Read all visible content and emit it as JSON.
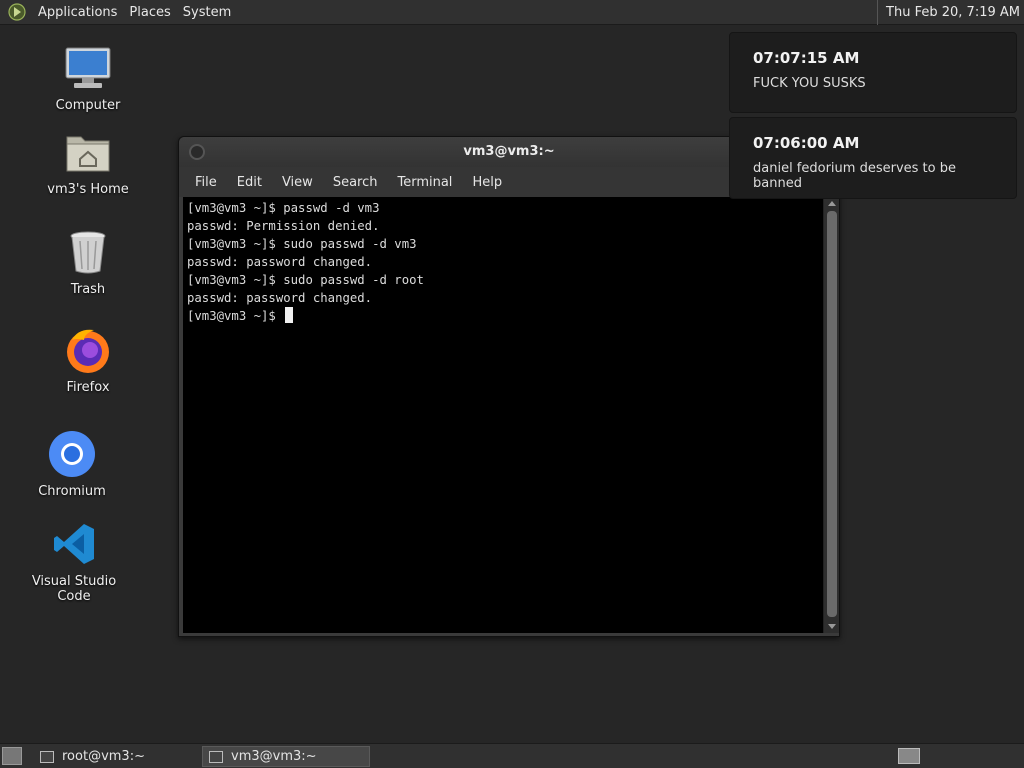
{
  "top_panel": {
    "menus": [
      "Applications",
      "Places",
      "System"
    ],
    "clock": "Thu Feb 20,  7:19 AM"
  },
  "desktop_icons": [
    {
      "label": "Computer",
      "icon": "computer-icon"
    },
    {
      "label": "vm3's Home",
      "icon": "home-folder-icon"
    },
    {
      "label": "Trash",
      "icon": "trash-icon"
    },
    {
      "label": "Firefox",
      "icon": "firefox-icon"
    },
    {
      "label": "Chromium",
      "icon": "chromium-icon"
    },
    {
      "label": "Visual Studio Code",
      "icon": "vscode-icon"
    }
  ],
  "terminal": {
    "title": "vm3@vm3:~",
    "menu": [
      "File",
      "Edit",
      "View",
      "Search",
      "Terminal",
      "Help"
    ],
    "lines": [
      "[vm3@vm3 ~]$ passwd -d vm3",
      "passwd: Permission denied.",
      "[vm3@vm3 ~]$ sudo passwd -d vm3",
      "passwd: password changed.",
      "[vm3@vm3 ~]$ sudo passwd -d root",
      "passwd: password changed.",
      "[vm3@vm3 ~]$ "
    ]
  },
  "notifications": [
    {
      "time": "07:07:15 AM",
      "message": "FUCK YOU SUSKS"
    },
    {
      "time": "07:06:00 AM",
      "message": "daniel fedorium deserves to be banned"
    }
  ],
  "taskbar": {
    "tasks": [
      {
        "label": "root@vm3:~",
        "active": false
      },
      {
        "label": "vm3@vm3:~",
        "active": true
      }
    ]
  }
}
